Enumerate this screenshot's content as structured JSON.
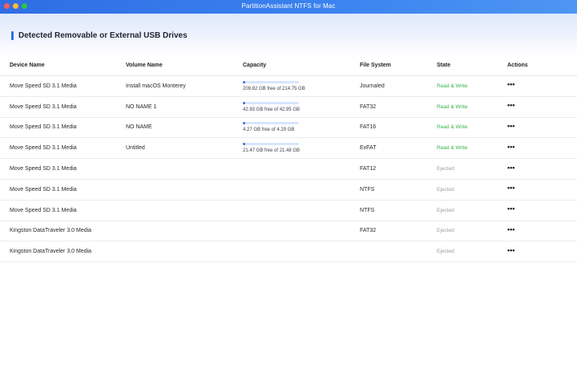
{
  "window": {
    "title": "PartitionAssistant NTFS for Mac"
  },
  "section": {
    "title": "Detected Removable or External USB Drives"
  },
  "table": {
    "headers": {
      "device": "Device Name",
      "volume": "Volume Name",
      "capacity": "Capacity",
      "fs": "File System",
      "state": "State",
      "actions": "Actions"
    },
    "rows": [
      {
        "device": "Move Speed SD 3.1 Media",
        "volume": "Install macOS Monterey",
        "capacity_text": "209.82 GB free of 214.75 GB",
        "used_fraction": 0.023,
        "fs": "Journaled",
        "state": "Read & Write",
        "actions": "•••"
      },
      {
        "device": "Move Speed SD 3.1 Media",
        "volume": "NO NAME 1",
        "capacity_text": "42.93 GB free of 42.95 GB",
        "used_fraction": 0.0005,
        "fs": "FAT32",
        "state": "Read & Write",
        "actions": "•••"
      },
      {
        "device": "Move Speed SD 3.1 Media",
        "volume": "NO NAME",
        "capacity_text": "4.27 GB free of 4.29 GB",
        "used_fraction": 0.005,
        "fs": "FAT16",
        "state": "Read & Write",
        "actions": "•••"
      },
      {
        "device": "Move Speed SD 3.1 Media",
        "volume": "Untitled",
        "capacity_text": "21.47 GB free of 21.48 GB",
        "used_fraction": 0.0005,
        "fs": "ExFAT",
        "state": "Read & Write",
        "actions": "•••"
      },
      {
        "device": "Move Speed SD 3.1 Media",
        "volume": "",
        "capacity_text": "",
        "fs": "FAT12",
        "state": "Ejected",
        "actions": "•••"
      },
      {
        "device": "Move Speed SD 3.1 Media",
        "volume": "",
        "capacity_text": "",
        "fs": "NTFS",
        "state": "Ejected",
        "actions": "•••"
      },
      {
        "device": "Move Speed SD 3.1 Media",
        "volume": "",
        "capacity_text": "",
        "fs": "NTFS",
        "state": "Ejected",
        "actions": "•••"
      },
      {
        "device": "Kingston DataTraveler 3.0 Media",
        "volume": "",
        "capacity_text": "",
        "fs": "FAT32",
        "state": "Ejected",
        "actions": "•••"
      },
      {
        "device": "Kingston DataTraveler 3.0 Media",
        "volume": "",
        "capacity_text": "",
        "fs": "",
        "state": "Ejected",
        "actions": "•••"
      }
    ]
  },
  "colors": {
    "accent": "#2f6de4",
    "read_write": "#38b349",
    "ejected": "#9a9ca2"
  }
}
